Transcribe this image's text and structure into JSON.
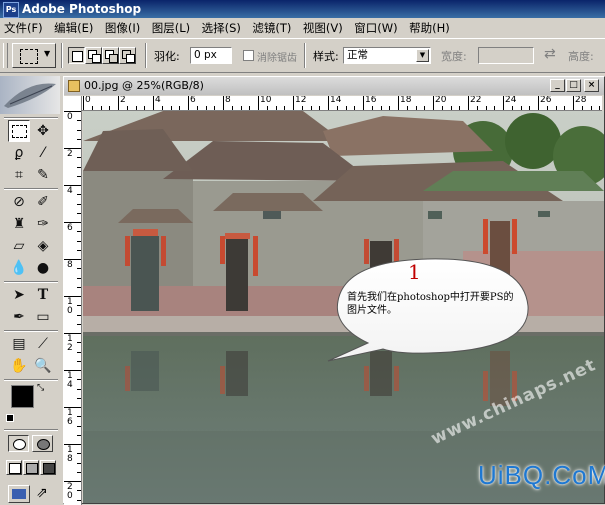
{
  "app": {
    "title": "Adobe Photoshop",
    "logo_text": "Ps"
  },
  "menu": [
    "文件(F)",
    "编辑(E)",
    "图像(I)",
    "图层(L)",
    "选择(S)",
    "滤镜(T)",
    "视图(V)",
    "窗口(W)",
    "帮助(H)"
  ],
  "options": {
    "feather_label": "羽化:",
    "feather_value": "0 px",
    "antialias_label": "消除锯齿",
    "style_label": "样式:",
    "style_value": "正常",
    "width_label": "宽度:",
    "height_label": "高度:"
  },
  "document": {
    "title": "00.jpg @ 25%(RGB/8)",
    "ruler_h": [
      "0",
      "2",
      "4",
      "6",
      "8",
      "10",
      "12",
      "14",
      "16",
      "18",
      "20",
      "22",
      "24",
      "26",
      "28"
    ],
    "ruler_v": [
      "0",
      "2",
      "4",
      "6",
      "8",
      "10",
      "12",
      "14",
      "16",
      "18",
      "20"
    ]
  },
  "annotation": {
    "number": "1",
    "text_line1": "首先我们在photoshop中打开要PS的",
    "text_line2": "图片文件。"
  },
  "watermarks": {
    "diagonal": "www.chinaps.net",
    "brand": "UiBQ.CoM"
  },
  "colors": {
    "title_start": "#0a246a",
    "title_end": "#3a6ea5",
    "chrome": "#d4d0c8",
    "number_red": "#c00000",
    "brand_blue": "#1e78d2"
  }
}
